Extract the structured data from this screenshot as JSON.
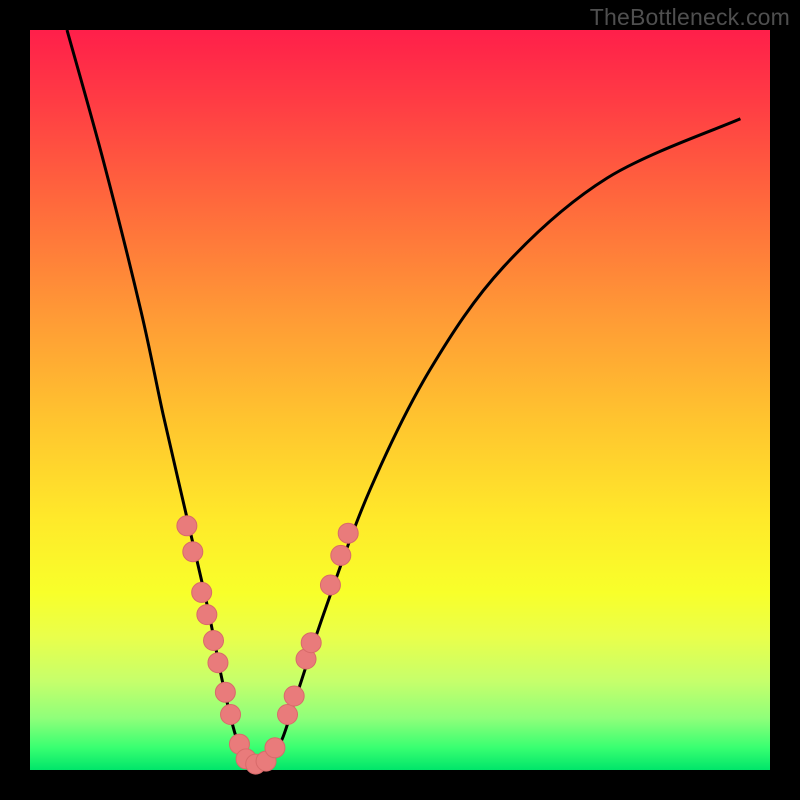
{
  "watermark": "TheBottleneck.com",
  "colors": {
    "frame": "#000000",
    "curve_stroke": "#000000",
    "marker_fill": "#e97b7b",
    "marker_stroke": "#d86a6a"
  },
  "chart_data": {
    "type": "line",
    "title": "",
    "xlabel": "",
    "ylabel": "",
    "xlim": [
      0,
      100
    ],
    "ylim": [
      0,
      100
    ],
    "note": "Axes are unlabeled; values are read off as percentage of plot width (x) and height (y, 0 at bottom). Curve is a V-shaped bottleneck curve with minimum near x≈30.",
    "series": [
      {
        "name": "bottleneck-curve",
        "x": [
          5,
          10,
          15,
          18,
          21,
          24,
          26,
          28,
          30,
          32,
          34,
          36,
          40,
          46,
          54,
          64,
          78,
          96
        ],
        "y": [
          100,
          82,
          62,
          48,
          35,
          22,
          12,
          4,
          1,
          1,
          4,
          10,
          22,
          38,
          54,
          68,
          80,
          88
        ]
      }
    ],
    "markers": {
      "name": "highlighted-points",
      "note": "Salmon circular markers on both flanks of the V, near the lower third.",
      "points": [
        {
          "x": 21.2,
          "y": 33.0
        },
        {
          "x": 22.0,
          "y": 29.5
        },
        {
          "x": 23.2,
          "y": 24.0
        },
        {
          "x": 23.9,
          "y": 21.0
        },
        {
          "x": 24.8,
          "y": 17.5
        },
        {
          "x": 25.4,
          "y": 14.5
        },
        {
          "x": 26.4,
          "y": 10.5
        },
        {
          "x": 27.1,
          "y": 7.5
        },
        {
          "x": 28.3,
          "y": 3.5
        },
        {
          "x": 29.2,
          "y": 1.5
        },
        {
          "x": 30.5,
          "y": 0.8
        },
        {
          "x": 31.9,
          "y": 1.2
        },
        {
          "x": 33.1,
          "y": 3.0
        },
        {
          "x": 34.8,
          "y": 7.5
        },
        {
          "x": 35.7,
          "y": 10.0
        },
        {
          "x": 37.3,
          "y": 15.0
        },
        {
          "x": 38.0,
          "y": 17.2
        },
        {
          "x": 40.6,
          "y": 25.0
        },
        {
          "x": 42.0,
          "y": 29.0
        },
        {
          "x": 43.0,
          "y": 32.0
        }
      ]
    }
  }
}
